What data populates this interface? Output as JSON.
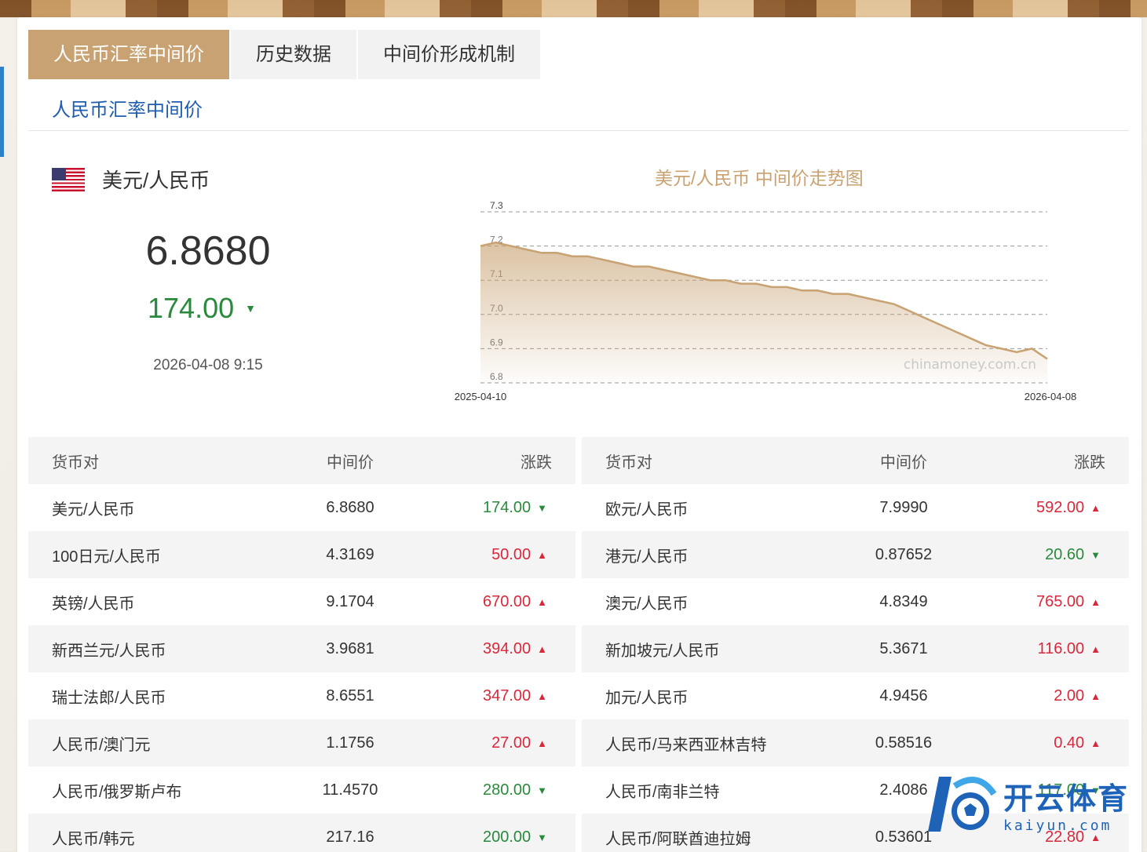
{
  "tabs": [
    {
      "label": "人民币汇率中间价",
      "active": true
    },
    {
      "label": "历史数据",
      "active": false
    },
    {
      "label": "中间价形成机制",
      "active": false
    }
  ],
  "subtitle": "人民币汇率中间价",
  "featured": {
    "pair": "美元/人民币",
    "flag_icon": "us-flag-icon",
    "rate": "6.8680",
    "change": "174.00",
    "direction": "down",
    "time": "2026-04-08 9:15"
  },
  "chart_data": {
    "type": "area",
    "title": "美元/人民币 中间价走势图",
    "x_range": [
      "2025-04-10",
      "2026-04-08"
    ],
    "ylim": [
      6.8,
      7.3
    ],
    "yticks": [
      "7.3",
      "7.2",
      "7.1",
      "7.0",
      "6.9",
      "6.8"
    ],
    "grid": true,
    "watermark": "chinamoney.com.cn",
    "line_color": "#c8a272",
    "values": [
      7.2,
      7.21,
      7.2,
      7.19,
      7.18,
      7.18,
      7.17,
      7.17,
      7.16,
      7.15,
      7.14,
      7.14,
      7.13,
      7.12,
      7.11,
      7.1,
      7.1,
      7.09,
      7.09,
      7.08,
      7.08,
      7.07,
      7.07,
      7.06,
      7.06,
      7.05,
      7.04,
      7.03,
      7.01,
      6.99,
      6.97,
      6.95,
      6.93,
      6.91,
      6.9,
      6.89,
      6.9,
      6.87
    ]
  },
  "table_headers": {
    "pair": "货币对",
    "mid": "中间价",
    "change": "涨跌"
  },
  "left_rows": [
    {
      "pair": "美元/人民币",
      "mid": "6.8680",
      "change": "174.00",
      "dir": "down"
    },
    {
      "pair": "100日元/人民币",
      "mid": "4.3169",
      "change": "50.00",
      "dir": "up"
    },
    {
      "pair": "英镑/人民币",
      "mid": "9.1704",
      "change": "670.00",
      "dir": "up"
    },
    {
      "pair": "新西兰元/人民币",
      "mid": "3.9681",
      "change": "394.00",
      "dir": "up"
    },
    {
      "pair": "瑞士法郎/人民币",
      "mid": "8.6551",
      "change": "347.00",
      "dir": "up"
    },
    {
      "pair": "人民币/澳门元",
      "mid": "1.1756",
      "change": "27.00",
      "dir": "up"
    },
    {
      "pair": "人民币/俄罗斯卢布",
      "mid": "11.4570",
      "change": "280.00",
      "dir": "down"
    },
    {
      "pair": "人民币/韩元",
      "mid": "217.16",
      "change": "200.00",
      "dir": "down"
    }
  ],
  "right_rows": [
    {
      "pair": "欧元/人民币",
      "mid": "7.9990",
      "change": "592.00",
      "dir": "up"
    },
    {
      "pair": "港元/人民币",
      "mid": "0.87652",
      "change": "20.60",
      "dir": "down"
    },
    {
      "pair": "澳元/人民币",
      "mid": "4.8349",
      "change": "765.00",
      "dir": "up"
    },
    {
      "pair": "新加坡元/人民币",
      "mid": "5.3671",
      "change": "116.00",
      "dir": "up"
    },
    {
      "pair": "加元/人民币",
      "mid": "4.9456",
      "change": "2.00",
      "dir": "up"
    },
    {
      "pair": "人民币/马来西亚林吉特",
      "mid": "0.58516",
      "change": "0.40",
      "dir": "up"
    },
    {
      "pair": "人民币/南非兰特",
      "mid": "2.4086",
      "change": "117.00",
      "dir": "down"
    },
    {
      "pair": "人民币/阿联酋迪拉姆",
      "mid": "0.53601",
      "change": "22.80",
      "dir": "up"
    }
  ],
  "colors": {
    "accent": "#c8a272",
    "up": "#d9283b",
    "down": "#2a8a3c",
    "link": "#1e5db0"
  },
  "watermark_logo": {
    "cn": "开云体育",
    "en": "kaiyun.com",
    "icon": "soccer-ball-logo-icon"
  }
}
